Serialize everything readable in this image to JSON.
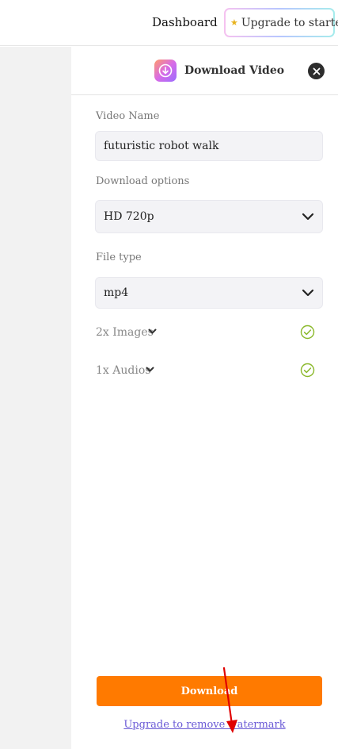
{
  "topbar": {
    "dashboard_label": "Dashboard",
    "upgrade_label": "Upgrade to starter",
    "star_icon": "star-icon"
  },
  "panel": {
    "title": "Download Video",
    "header_icon": "download-circle-icon",
    "close_icon": "close-icon"
  },
  "form": {
    "video_name_label": "Video Name",
    "video_name_value": "futuristic robot walk",
    "download_options_label": "Download options",
    "download_options_value": "HD 720p",
    "file_type_label": "File type",
    "file_type_value": "mp4"
  },
  "assets": [
    {
      "label": "2x Images",
      "status": "check-icon"
    },
    {
      "label": "1x Audios",
      "status": "check-icon"
    }
  ],
  "actions": {
    "download_label": "Download",
    "watermark_link": "Upgrade to remove watermark"
  },
  "colors": {
    "accent_orange": "#ff7a00",
    "link_purple": "#6a5ad6",
    "check_green": "#8ab82a",
    "annotation_arrow": "#e00000"
  }
}
